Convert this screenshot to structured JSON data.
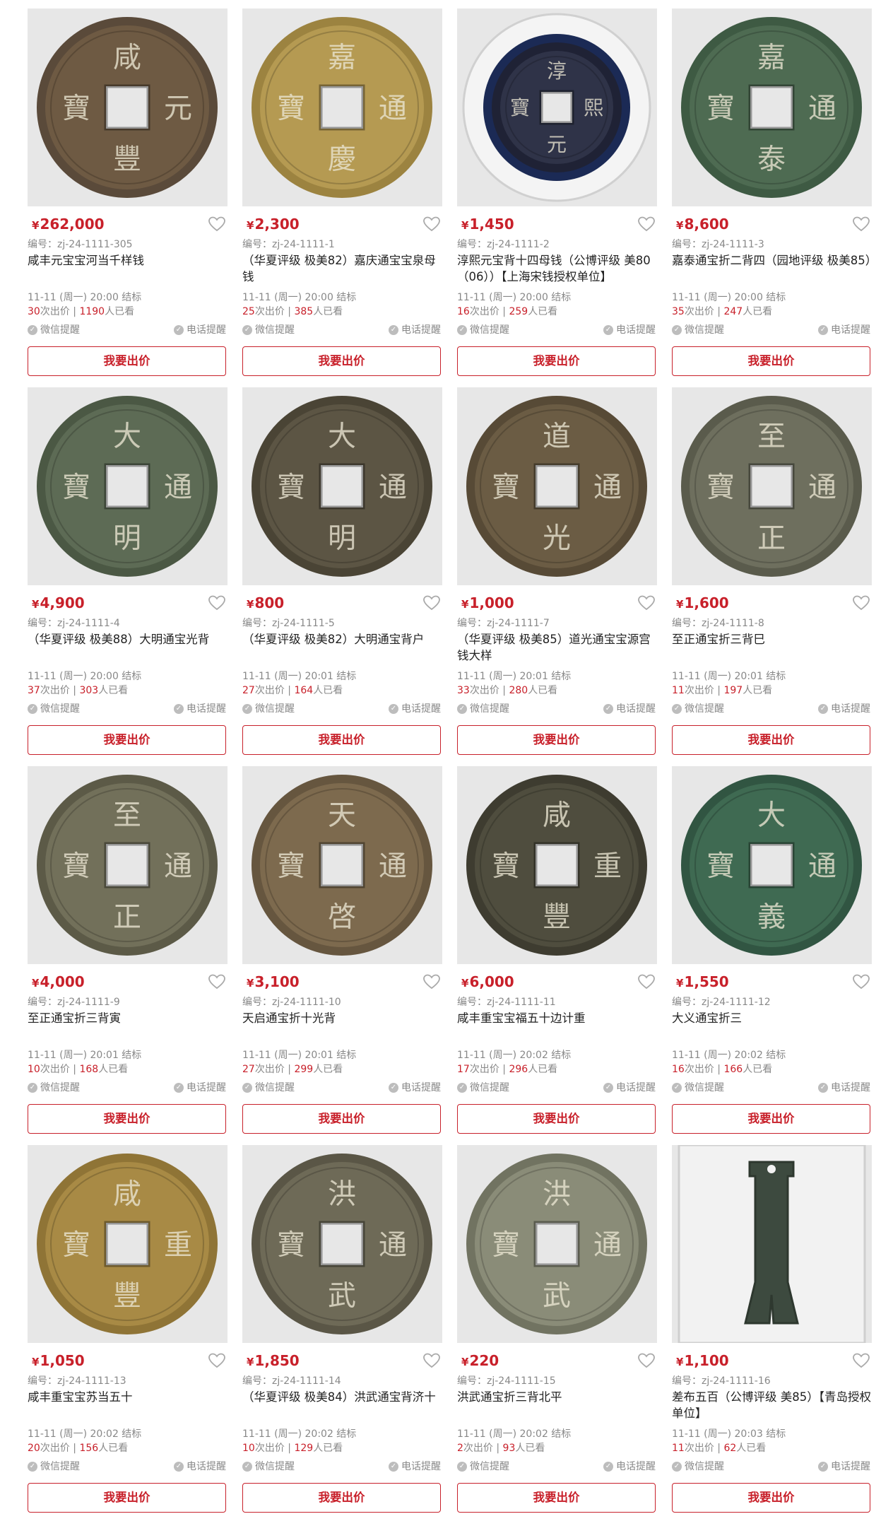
{
  "labels": {
    "lot_prefix": "编号：",
    "bids_suffix": "次出价",
    "views_suffix": "人已看",
    "wechat_remind": "微信提醒",
    "phone_remind": "电话提醒",
    "bid_button": "我要出价",
    "currency": "¥"
  },
  "colors": {
    "accent": "#c8202a",
    "muted": "#888888",
    "image_bg": "#e9e9e9"
  },
  "lots": [
    {
      "price": "262,000",
      "lot": "zj-24-1111-305",
      "title": "咸丰元宝宝河当千样钱",
      "end": "11-11 (周一) 20:00 结标",
      "bids": "30",
      "views": "1190",
      "coin_text": [
        "咸",
        "元",
        "豐",
        "寶"
      ],
      "coin_tone": "#6e5a43",
      "rim": "#5a4a3a",
      "holder": false
    },
    {
      "price": "2,300",
      "lot": "zj-24-1111-1",
      "title": "（华夏评级 极美82）嘉庆通宝宝泉母钱",
      "end": "11-11 (周一) 20:00 结标",
      "bids": "25",
      "views": "385",
      "coin_text": [
        "嘉",
        "通",
        "慶",
        "寶"
      ],
      "coin_tone": "#b59a52",
      "rim": "#9c8340",
      "holder": false
    },
    {
      "price": "1,450",
      "lot": "zj-24-1111-2",
      "title": "淳熙元宝背十四母钱（公博评级 美80（06））【上海宋钱授权单位】",
      "end": "11-11 (周一) 20:00 结标",
      "bids": "16",
      "views": "259",
      "coin_text": [
        "淳",
        "熙",
        "元",
        "寶"
      ],
      "coin_tone": "#2f3348",
      "rim": "#1f2235",
      "holder": true
    },
    {
      "price": "8,600",
      "lot": "zj-24-1111-3",
      "title": "嘉泰通宝折二背四（园地评级 极美85）",
      "end": "11-11 (周一) 20:00 结标",
      "bids": "35",
      "views": "247",
      "coin_text": [
        "嘉",
        "通",
        "泰",
        "寶"
      ],
      "coin_tone": "#4e6b52",
      "rim": "#3e5a43",
      "holder": false
    },
    {
      "price": "4,900",
      "lot": "zj-24-1111-4",
      "title": "（华夏评级 极美88）大明通宝光背",
      "end": "11-11 (周一) 20:00 结标",
      "bids": "37",
      "views": "303",
      "coin_text": [
        "大",
        "通",
        "明",
        "寶"
      ],
      "coin_tone": "#5d6b55",
      "rim": "#4b5844",
      "holder": false
    },
    {
      "price": "800",
      "lot": "zj-24-1111-5",
      "title": "（华夏评级 极美82）大明通宝背户",
      "end": "11-11 (周一) 20:01 结标",
      "bids": "27",
      "views": "164",
      "coin_text": [
        "大",
        "通",
        "明",
        "寶"
      ],
      "coin_tone": "#5c5544",
      "rim": "#4a4435",
      "holder": false
    },
    {
      "price": "1,000",
      "lot": "zj-24-1111-7",
      "title": "（华夏评级 极美85）道光通宝宝源宫钱大样",
      "end": "11-11 (周一) 20:01 结标",
      "bids": "33",
      "views": "280",
      "coin_text": [
        "道",
        "通",
        "光",
        "寶"
      ],
      "coin_tone": "#6b5c44",
      "rim": "#574a36",
      "holder": false
    },
    {
      "price": "1,600",
      "lot": "zj-24-1111-8",
      "title": "至正通宝折三背巳",
      "end": "11-11 (周一) 20:01 结标",
      "bids": "11",
      "views": "197",
      "coin_text": [
        "至",
        "通",
        "正",
        "寶"
      ],
      "coin_tone": "#6e6f5e",
      "rim": "#5a5b4c",
      "holder": false
    },
    {
      "price": "4,000",
      "lot": "zj-24-1111-9",
      "title": "至正通宝折三背寅",
      "end": "11-11 (周一) 20:01 结标",
      "bids": "10",
      "views": "168",
      "coin_text": [
        "至",
        "通",
        "正",
        "寶"
      ],
      "coin_tone": "#72705a",
      "rim": "#5c5a47",
      "holder": false
    },
    {
      "price": "3,100",
      "lot": "zj-24-1111-10",
      "title": "天启通宝折十光背",
      "end": "11-11 (周一) 20:01 结标",
      "bids": "27",
      "views": "299",
      "coin_text": [
        "天",
        "通",
        "啓",
        "寶"
      ],
      "coin_tone": "#7d6a4e",
      "rim": "#66563f",
      "holder": false
    },
    {
      "price": "6,000",
      "lot": "zj-24-1111-11",
      "title": "咸丰重宝宝福五十边计重",
      "end": "11-11 (周一) 20:02 结标",
      "bids": "17",
      "views": "296",
      "coin_text": [
        "咸",
        "重",
        "豐",
        "寶"
      ],
      "coin_tone": "#4f4d3e",
      "rim": "#3e3c30",
      "holder": false
    },
    {
      "price": "1,550",
      "lot": "zj-24-1111-12",
      "title": "大义通宝折三",
      "end": "11-11 (周一) 20:02 结标",
      "bids": "16",
      "views": "166",
      "coin_text": [
        "大",
        "通",
        "義",
        "寶"
      ],
      "coin_tone": "#3f6a52",
      "rim": "#315542",
      "holder": false
    },
    {
      "price": "1,050",
      "lot": "zj-24-1111-13",
      "title": "咸丰重宝宝苏当五十",
      "end": "11-11 (周一) 20:02 结标",
      "bids": "20",
      "views": "156",
      "coin_text": [
        "咸",
        "重",
        "豐",
        "寶"
      ],
      "coin_tone": "#a88a45",
      "rim": "#8f7436",
      "holder": false
    },
    {
      "price": "1,850",
      "lot": "zj-24-1111-14",
      "title": "（华夏评级 极美84）洪武通宝背济十",
      "end": "11-11 (周一) 20:02 结标",
      "bids": "10",
      "views": "129",
      "coin_text": [
        "洪",
        "通",
        "武",
        "寶"
      ],
      "coin_tone": "#6e6a57",
      "rim": "#5a5646",
      "holder": false
    },
    {
      "price": "220",
      "lot": "zj-24-1111-15",
      "title": "洪武通宝折三背北平",
      "end": "11-11 (周一) 20:02 结标",
      "bids": "2",
      "views": "93",
      "coin_text": [
        "洪",
        "通",
        "武",
        "寶"
      ],
      "coin_tone": "#8a8c78",
      "rim": "#717361",
      "holder": false
    },
    {
      "price": "1,100",
      "lot": "zj-24-1111-16",
      "title": "差布五百（公博评级 美85）【青岛授权单位】",
      "end": "11-11 (周一) 20:03 结标",
      "bids": "11",
      "views": "62",
      "coin_text": [],
      "coin_tone": "#3d4a3f",
      "rim": "#2e382f",
      "holder": true,
      "spade": true
    }
  ]
}
